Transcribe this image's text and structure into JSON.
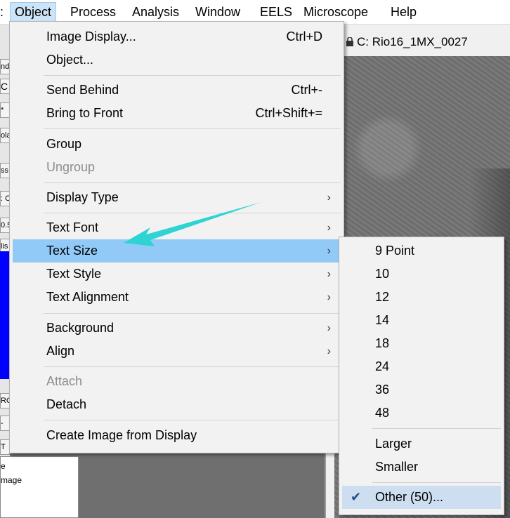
{
  "menubar": {
    "items": [
      {
        "label": "Object"
      },
      {
        "label": "Process"
      },
      {
        "label": "Analysis"
      },
      {
        "label": "Window"
      },
      {
        "label": "EELS"
      },
      {
        "label": "Microscope"
      },
      {
        "label": "Help"
      }
    ]
  },
  "image_window": {
    "title": "C: Rio16_1MX_0027"
  },
  "left_palette": {
    "fragments": [
      "nd",
      "C",
      "*",
      "ola",
      "ss:",
      ": C",
      "0.5",
      "lis",
      "RO",
      "-",
      "T",
      "e",
      "mage"
    ]
  },
  "object_menu": {
    "items": [
      {
        "label": "Image Display...",
        "shortcut": "Ctrl+D"
      },
      {
        "label": "Object..."
      },
      {
        "label": "Send Behind",
        "shortcut": "Ctrl+-"
      },
      {
        "label": "Bring to Front",
        "shortcut": "Ctrl+Shift+="
      },
      {
        "label": "Group"
      },
      {
        "label": "Ungroup"
      },
      {
        "label": "Display Type",
        "arrow": "›"
      },
      {
        "label": "Text Font",
        "arrow": "›"
      },
      {
        "label": "Text Size",
        "arrow": "›"
      },
      {
        "label": "Text Style",
        "arrow": "›"
      },
      {
        "label": "Text Alignment",
        "arrow": "›"
      },
      {
        "label": "Background",
        "arrow": "›"
      },
      {
        "label": "Align",
        "arrow": "›"
      },
      {
        "label": "Attach"
      },
      {
        "label": "Detach"
      },
      {
        "label": "Create Image from Display"
      }
    ]
  },
  "text_size_submenu": {
    "items": [
      {
        "label": "9 Point"
      },
      {
        "label": "10"
      },
      {
        "label": "12"
      },
      {
        "label": "14"
      },
      {
        "label": "18"
      },
      {
        "label": "24"
      },
      {
        "label": "36"
      },
      {
        "label": "48"
      },
      {
        "label": "Larger"
      },
      {
        "label": "Smaller"
      },
      {
        "label": "Other (50)...",
        "check": "✔"
      }
    ]
  },
  "colors": {
    "highlight": "#91c9f7",
    "annotation_arrow": "#2ed3d3",
    "plot_blue": "#0000ff"
  }
}
